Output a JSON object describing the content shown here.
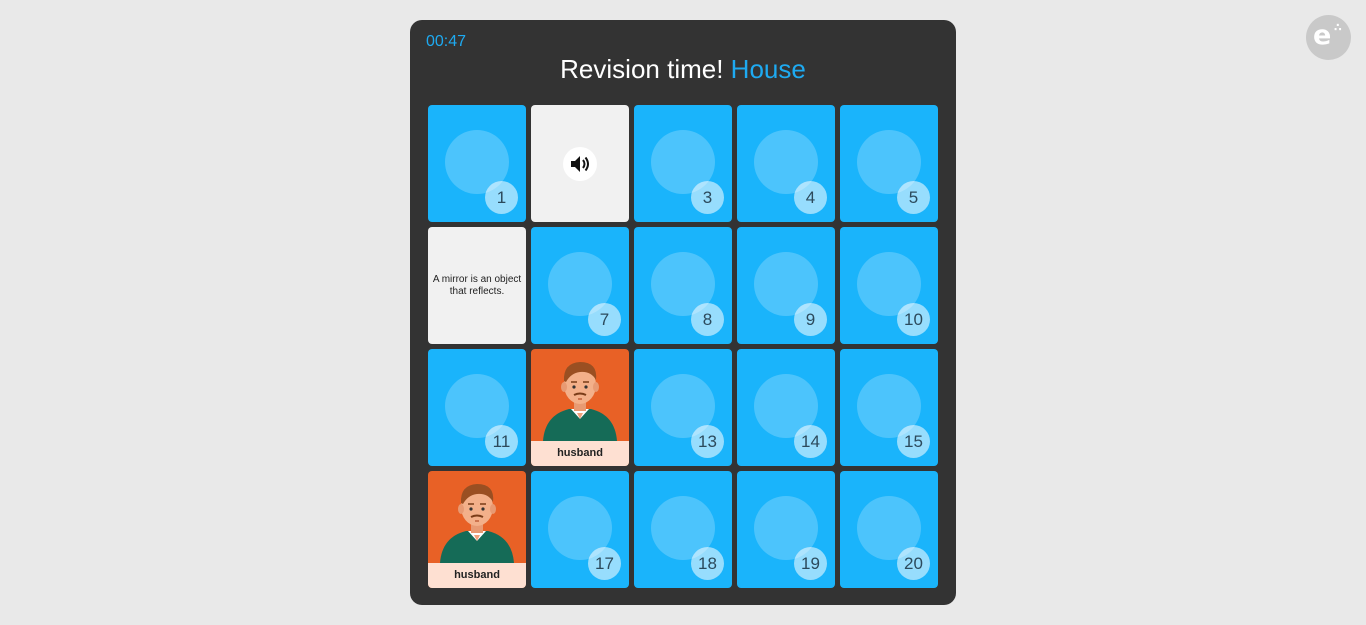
{
  "timer": "00:47",
  "title": {
    "prefix": "Revision time!",
    "topic": "House"
  },
  "cards": [
    {
      "type": "hidden",
      "number": "1"
    },
    {
      "type": "audio"
    },
    {
      "type": "hidden",
      "number": "3"
    },
    {
      "type": "hidden",
      "number": "4"
    },
    {
      "type": "hidden",
      "number": "5"
    },
    {
      "type": "text",
      "text": "A mirror is an object that reflects."
    },
    {
      "type": "hidden",
      "number": "7"
    },
    {
      "type": "hidden",
      "number": "8"
    },
    {
      "type": "hidden",
      "number": "9"
    },
    {
      "type": "hidden",
      "number": "10"
    },
    {
      "type": "hidden",
      "number": "11"
    },
    {
      "type": "picture",
      "label": "husband"
    },
    {
      "type": "hidden",
      "number": "13"
    },
    {
      "type": "hidden",
      "number": "14"
    },
    {
      "type": "hidden",
      "number": "15"
    },
    {
      "type": "picture",
      "label": "husband"
    },
    {
      "type": "hidden",
      "number": "17"
    },
    {
      "type": "hidden",
      "number": "18"
    },
    {
      "type": "hidden",
      "number": "19"
    },
    {
      "type": "hidden",
      "number": "20"
    }
  ],
  "colors": {
    "accent": "#1eaaf1",
    "card": "#1ab4fb",
    "panel": "#333333",
    "picture_bg": "#e86126"
  }
}
